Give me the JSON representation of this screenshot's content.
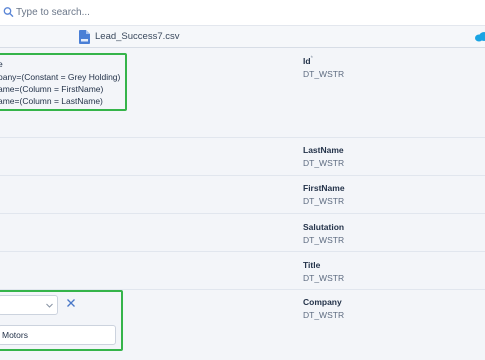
{
  "search": {
    "placeholder": "Type to search...",
    "value": ""
  },
  "file": {
    "name": "Lead_Success7.csv"
  },
  "mapping_rows": [
    {
      "expression_header": "e",
      "expression_lines": [
        "pany=(Constant = Grey Holding)",
        "ame=(Column = FirstName)",
        "ame=(Column = LastName)"
      ],
      "field_name": "Id",
      "required_marker": "*",
      "field_type": "DT_WSTR"
    },
    {
      "field_name": "LastName",
      "field_type": "DT_WSTR"
    },
    {
      "field_name": "FirstName",
      "field_type": "DT_WSTR"
    },
    {
      "field_name": "Salutation",
      "field_type": "DT_WSTR"
    },
    {
      "field_name": "Title",
      "field_type": "DT_WSTR"
    },
    {
      "field_name": "Company",
      "field_type": "DT_WSTR",
      "source_select_value": "",
      "constant_value": "Motors"
    }
  ],
  "colors": {
    "highlight": "#35b44a",
    "file_icon": "#4a7fd6",
    "cloud_icon": "#1aa4e3",
    "search_icon": "#5b86d6"
  }
}
